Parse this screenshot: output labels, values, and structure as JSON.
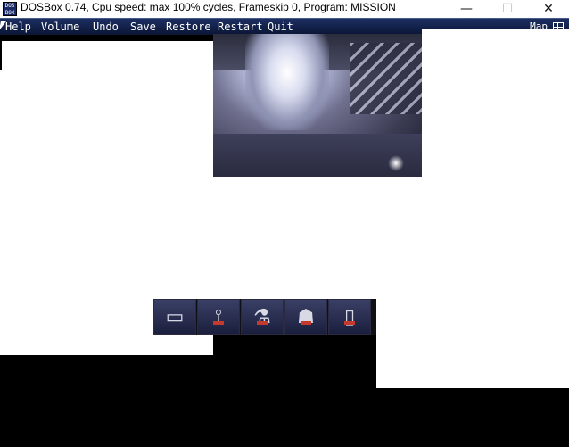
{
  "window": {
    "title": "DOSBox 0.74, Cpu speed: max 100% cycles, Frameskip  0, Program:  MISSION",
    "icon_text": "DOS BOX",
    "minimize_glyph": "—",
    "maximize_glyph": "☐",
    "close_glyph": "✕"
  },
  "menubar": {
    "items": [
      "Help",
      "Volume",
      "Undo",
      "Save",
      "Restore",
      "Restart",
      "Quit"
    ],
    "right_label": "Map"
  },
  "inventory": {
    "slots": [
      {
        "name": "map-paper-icon",
        "glyph": "▭"
      },
      {
        "name": "antenna-icon",
        "glyph": "⟟"
      },
      {
        "name": "canister-device-icon",
        "glyph": "⚗"
      },
      {
        "name": "robot-figure-icon",
        "glyph": "☗"
      },
      {
        "name": "cylinder-icon",
        "glyph": "▯"
      }
    ]
  },
  "colors": {
    "menubar": "#1c2f62",
    "accent_red": "#c43a2e"
  }
}
